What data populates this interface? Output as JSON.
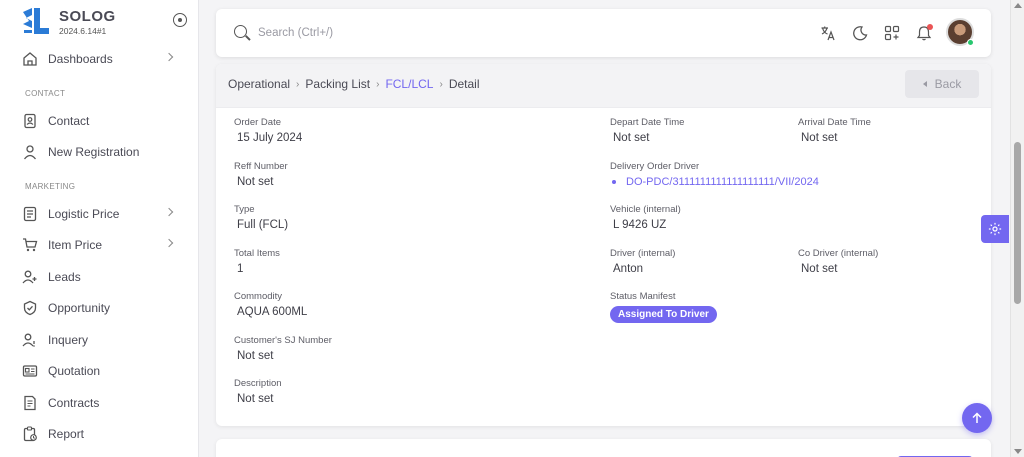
{
  "app": {
    "name": "SOLOG",
    "version": "2024.6.14#1"
  },
  "sidebar": {
    "items": [
      {
        "label": "Dashboards",
        "icon": "home-icon",
        "has_children": true
      },
      {
        "section": "CONTACT"
      },
      {
        "label": "Contact",
        "icon": "contact-book-icon",
        "has_children": false
      },
      {
        "label": "New Registration",
        "icon": "user-icon",
        "has_children": false
      },
      {
        "section": "MARKETING"
      },
      {
        "label": "Logistic Price",
        "icon": "list-icon",
        "has_children": true
      },
      {
        "label": "Item Price",
        "icon": "cart-icon",
        "has_children": true
      },
      {
        "label": "Leads",
        "icon": "user-plus-icon",
        "has_children": false
      },
      {
        "label": "Opportunity",
        "icon": "shield-icon",
        "has_children": false
      },
      {
        "label": "Inquery",
        "icon": "user-question-icon",
        "has_children": false
      },
      {
        "label": "Quotation",
        "icon": "id-card-icon",
        "has_children": false
      },
      {
        "label": "Contracts",
        "icon": "document-icon",
        "has_children": false
      },
      {
        "label": "Report",
        "icon": "report-icon",
        "has_children": false
      }
    ]
  },
  "topbar": {
    "search_placeholder": "Search (Ctrl+/)",
    "icons": [
      "translate-icon",
      "moon-icon",
      "apps-add-icon",
      "bell-icon"
    ],
    "has_notification": true,
    "user_online": true
  },
  "breadcrumb": {
    "items": [
      "Operational",
      "Packing List",
      "FCL/LCL",
      "Detail"
    ],
    "active_index": 2
  },
  "back_label": "Back",
  "detail": {
    "order_date": {
      "label": "Order Date",
      "value": "15 July 2024"
    },
    "reff_number": {
      "label": "Reff Number",
      "value": "Not set"
    },
    "type": {
      "label": "Type",
      "value": "Full (FCL)"
    },
    "total_items": {
      "label": "Total Items",
      "value": "1"
    },
    "commodity": {
      "label": "Commodity",
      "value": "AQUA 600ML"
    },
    "customer_sj": {
      "label": "Customer's SJ Number",
      "value": "Not set"
    },
    "description": {
      "label": "Description",
      "value": "Not set"
    },
    "depart": {
      "label": "Depart Date Time",
      "value": "Not set"
    },
    "arrival": {
      "label": "Arrival Date Time",
      "value": "Not set"
    },
    "do_driver": {
      "label": "Delivery Order Driver",
      "value": "DO-PDC/3111111111111111111/VII/2024"
    },
    "vehicle": {
      "label": "Vehicle (internal)",
      "value": "L 9426 UZ"
    },
    "driver": {
      "label": "Driver (internal)",
      "value": "Anton"
    },
    "co_driver": {
      "label": "Co Driver (internal)",
      "value": "Not set"
    },
    "status_manifest": {
      "label": "Status Manifest",
      "value": "Assigned To Driver"
    }
  },
  "colors": {
    "primary": "#7367f0",
    "notification": "#ea5455",
    "online": "#28c76f"
  }
}
